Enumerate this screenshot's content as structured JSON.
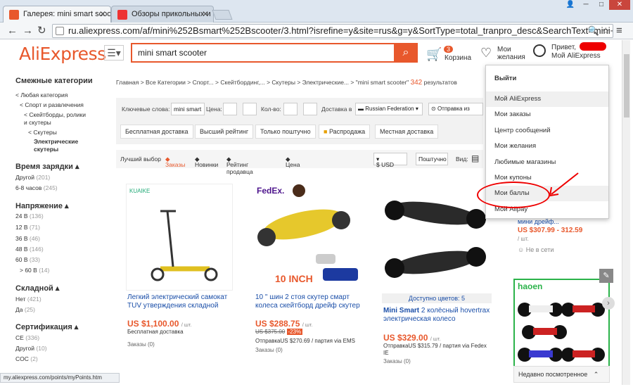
{
  "browser": {
    "tabs": [
      {
        "label": "Галерея: mini smart scooter",
        "fav_color": "#e8582c"
      },
      {
        "label": "Обзоры прикольных и необ",
        "fav_color": "#e33"
      }
    ],
    "url": "ru.aliexpress.com/af/mini%252Bsmart%252Bscooter/3.html?isrefine=y&site=rus&g=y&SortType=total_tranpro_desc&SearchText=mini+",
    "status_url": "my.aliexpress.com/points/myPoints.htm"
  },
  "header": {
    "logo": "AliExpress",
    "search_value": "mini smart scooter",
    "cart_count": "3",
    "cart_label": "Корзина",
    "wish_label1": "Мои",
    "wish_label2": "желания",
    "acct_line1": "Привет,",
    "acct_line2": "Мой AliExpress"
  },
  "sidebar": {
    "related_title": "Смежные категории",
    "cats": [
      "< Любая категория",
      "< Спорт и развлечения",
      "< Скейтборды, ролики",
      "и скутеры",
      "< Скутеры",
      "Электрические",
      "скутеры"
    ],
    "charge_title": "Время зарядки",
    "charge": [
      [
        "Другой",
        "(201)"
      ],
      [
        "6-8 часов",
        "(245)"
      ]
    ],
    "volt_title": "Напряжение",
    "volt": [
      [
        "24 В",
        "(136)"
      ],
      [
        "12 В",
        "(71)"
      ],
      [
        "36 В",
        "(46)"
      ],
      [
        "48 В",
        "(146)"
      ],
      [
        "60 В",
        "(33)"
      ],
      [
        "> 60 В",
        "(14)"
      ]
    ],
    "fold_title": "Складной",
    "fold": [
      [
        "Нет",
        "(421)"
      ],
      [
        "Да",
        "(25)"
      ]
    ],
    "cert_title": "Сертификация",
    "cert": [
      [
        "CE",
        "(336)"
      ],
      [
        "Другой",
        "(10)"
      ],
      [
        "COC",
        "(2)"
      ]
    ]
  },
  "crumb": {
    "text": "Главная > Все Категории > Спорт... > Скейтбординг,... > Скутеры > Электрические... > \"mini smart scooter\"",
    "count": "342",
    "suffix": "результатов"
  },
  "filters": {
    "kw_label": "Ключевые слова:",
    "kw_value": "mini smart",
    "price_label": "Цена:",
    "qty_label": "Кол-во:",
    "delivery_label": "Доставка в",
    "country": "Russian Federation",
    "ship_from": "Отправка из",
    "chips": [
      "Бесплатная доставка",
      "Высший рейтинг",
      "Только поштучно",
      "Распродажа",
      "Местная доставка"
    ]
  },
  "sort": {
    "items": [
      "Лучший выбор",
      "Заказы",
      "Новинки",
      "Рейтинг продавца",
      "Цена"
    ],
    "currency": "$ USD",
    "unit": "Поштучно",
    "view": "Вид:"
  },
  "products": [
    {
      "brand": "KUAIKE",
      "title": "Легкий электрический самокат TUV утверждения складной",
      "price": "US $1,100.00",
      "unit": "/ шт.",
      "shipping": "Бесплатная доставка",
      "orders": "Заказы (0)"
    },
    {
      "brand": "FedEx.",
      "title": "10 \" шин 2 стоя скутер смарт колеса скейтборд дрейф скутер",
      "price": "US $288.75",
      "unit": "/ шт.",
      "old": "US $375.00",
      "disc": "-23%",
      "shipping": "ОтправкаUS $270.69 / партия via EMS",
      "orders": "Заказы (0)"
    },
    {
      "colors": "Доступно цветов: 5",
      "title_bold": "Mini Smart",
      "title": "2 колёсный hovertrax электрическая колесо",
      "price": "US $329.00",
      "unit": "/ шт.",
      "old": "",
      "shipping": "ОтправкаUS $315.79 / партия via Fedex IE",
      "orders": "Заказы (0)"
    }
  ],
  "dropdown": {
    "logout": "Выйти",
    "items": [
      "Мой AliExpress",
      "Мои заказы",
      "Центр сообщений",
      "Мои желания",
      "Любимые магазины",
      "Мои купоны",
      "Мои баллы",
      "Мой Alipay"
    ]
  },
  "rightcol": {
    "title": "мини дрейф...",
    "price": "US $307.99 - 312.59",
    "unit": "/ шт.",
    "net": "Не в сети",
    "brand": "haoen"
  },
  "recent": "Недавно посмотренное"
}
